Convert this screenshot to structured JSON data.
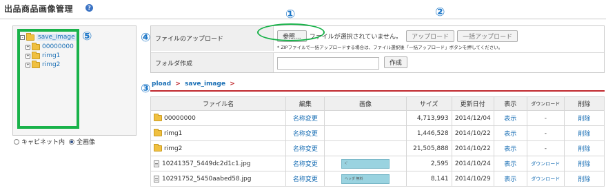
{
  "header": {
    "title": "出品商品画像管理",
    "help_icon": "?"
  },
  "tree": {
    "root": "save_image",
    "children": [
      "00000000",
      "rimg1",
      "rimg2"
    ],
    "expander_closed": "+",
    "expander_open": "-"
  },
  "scope": {
    "option_cabinet": "キャビネット内",
    "option_all": "全画像",
    "selected": "all"
  },
  "upload": {
    "label": "ファイルのアップロード",
    "browse_label": "参照...",
    "file_status": "ファイルが選択されていません。",
    "upload_button": "アップロード",
    "bulk_upload_button": "一括アップロード",
    "zip_note": "* ZIPファイルで一括アップロードする場合は、ファイル選択後「一括アップロード」ボタンを押してください。"
  },
  "folder_create": {
    "label": "フォルダ作成",
    "input_value": "",
    "create_button": "作成"
  },
  "breadcrumb": {
    "part1": "pload",
    "sep": ">",
    "part2": "save_image",
    "trail": ">"
  },
  "table": {
    "headers": [
      "ファイル名",
      "編集",
      "画像",
      "サイズ",
      "更新日付",
      "表示",
      "ダウンロード",
      "削除"
    ],
    "rows": [
      {
        "name": "00000000",
        "kind": "folder",
        "edit": "名称変更",
        "thumb": "",
        "size": "4,713,993",
        "date": "2014/12/04",
        "view": "表示",
        "download": "-",
        "delete": "削除"
      },
      {
        "name": "rimg1",
        "kind": "folder",
        "edit": "名称変更",
        "thumb": "",
        "size": "1,446,528",
        "date": "2014/10/22",
        "view": "表示",
        "download": "-",
        "delete": "削除"
      },
      {
        "name": "rimg2",
        "kind": "folder",
        "edit": "名称変更",
        "thumb": "",
        "size": "21,505,888",
        "date": "2014/10/22",
        "view": "表示",
        "download": "-",
        "delete": "削除"
      },
      {
        "name": "10241357_5449dc2d1c1.jpg",
        "kind": "file",
        "edit": "名称変更",
        "thumb": "ﾍﾟ",
        "size": "2,595",
        "date": "2014/10/24",
        "view": "表示",
        "download": "ダウンロード",
        "delete": "削除"
      },
      {
        "name": "10291752_5450aabed58.jpg",
        "kind": "file",
        "edit": "名称変更",
        "thumb": "ヘッダ 無料",
        "size": "8,141",
        "date": "2014/10/29",
        "view": "表示",
        "download": "ダウンロード",
        "delete": "削除"
      }
    ]
  },
  "markers": {
    "m1": "①",
    "m2": "②",
    "m3": "③",
    "m4": "④",
    "m5": "⑤"
  },
  "colors": {
    "marker": "#1f78c8",
    "highlight": "#19b24a",
    "link": "#1a6fb5",
    "rule": "#c0262c"
  }
}
